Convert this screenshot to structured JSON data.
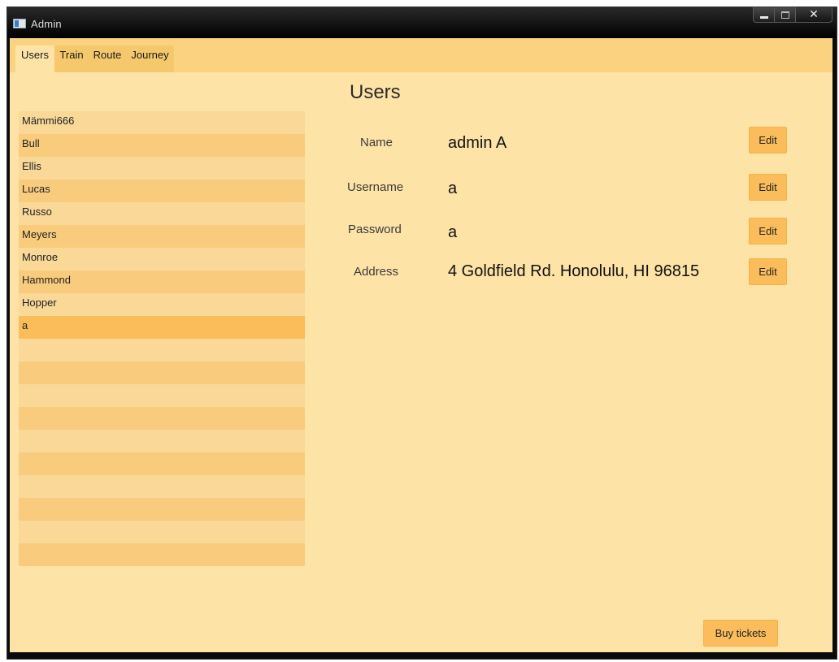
{
  "window": {
    "title": "Admin"
  },
  "tabs": [
    {
      "label": "Users",
      "active": true
    },
    {
      "label": "Train",
      "active": false
    },
    {
      "label": "Route",
      "active": false
    },
    {
      "label": "Journey",
      "active": false
    }
  ],
  "page": {
    "title": "Users"
  },
  "users": {
    "items": [
      "Mämmi666",
      "Bull",
      "Ellis",
      "Lucas",
      "Russo",
      "Meyers",
      "Monroe",
      "Hammond",
      "Hopper",
      "a"
    ],
    "selected": "a"
  },
  "details": {
    "name": {
      "label": "Name",
      "value": "admin A"
    },
    "username": {
      "label": "Username",
      "value": "a"
    },
    "password": {
      "label": "Password",
      "value": "a"
    },
    "address": {
      "label": "Address",
      "value": "4 Goldfield Rd. Honolulu, HI 96815"
    },
    "edit_label": "Edit"
  },
  "actions": {
    "buy_tickets": "Buy tickets"
  },
  "icons": {
    "app": "window-app-icon",
    "minimize": "minimize-icon",
    "maximize": "maximize-icon",
    "close": "close-icon"
  },
  "colors": {
    "background": "#fee3a6",
    "tabbar": "#fbd27f",
    "button": "#fbbd5b",
    "row_selected": "#fabd5a"
  }
}
